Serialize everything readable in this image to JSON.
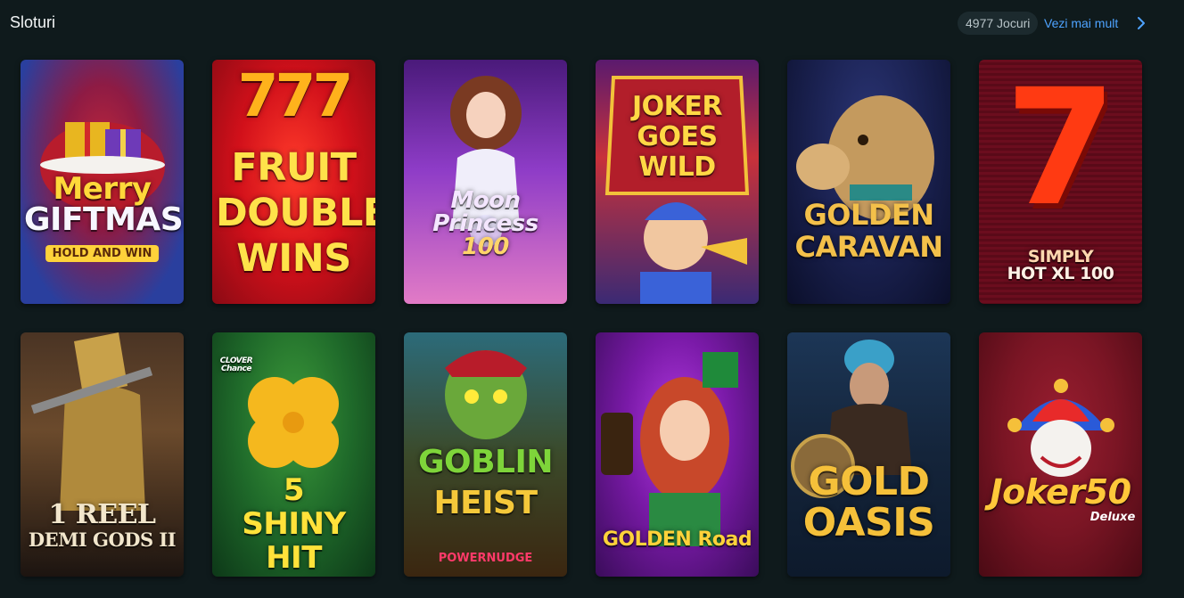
{
  "section": {
    "title": "Sloturi",
    "count_badge": "4977 Jocuri",
    "see_more_label": "Vezi mai mult",
    "chevron_icon": "chevron-right-icon"
  },
  "games": [
    {
      "id": "merry-giftmas",
      "lines": [
        "Merry",
        "GIFTMAS"
      ],
      "sub": "HOLD AND WIN",
      "colors": [
        "#2a3f9e",
        "#c2273a"
      ]
    },
    {
      "id": "fruit-double-wins",
      "lines": [
        "FRUIT",
        "DOUBLE",
        "WINS"
      ],
      "top": "777",
      "colors": [
        "#d1101a",
        "#8a0a14"
      ]
    },
    {
      "id": "moon-princess-100",
      "lines": [
        "Moon",
        "Princess",
        "100"
      ],
      "colors": [
        "#8e3cc7",
        "#e27bc6"
      ]
    },
    {
      "id": "joker-goes-wild",
      "lines": [
        "JOKER",
        "GOES",
        "WILD"
      ],
      "colors": [
        "#c8313a",
        "#3b2a74"
      ]
    },
    {
      "id": "golden-caravan",
      "lines": [
        "GOLDEN",
        "CARAVAN"
      ],
      "colors": [
        "#1a2150",
        "#0b0f2a"
      ]
    },
    {
      "id": "simply-hot-xl",
      "lines": [
        "7",
        "SIMPLY",
        "HOT XL 100"
      ],
      "colors": [
        "#6b0d1e",
        "#3d0612"
      ]
    },
    {
      "id": "1-reel-demi-gods-ii",
      "lines": [
        "1 REEL",
        "DEMI GODS II"
      ],
      "colors": [
        "#6b4a2c",
        "#1c1410"
      ]
    },
    {
      "id": "5-shiny-hit",
      "lines": [
        "5",
        "SHINY",
        "HIT"
      ],
      "top": "CLOVER Chance",
      "colors": [
        "#1f6a2a",
        "#0d3818"
      ]
    },
    {
      "id": "goblin-heist-powernudge",
      "lines": [
        "GOBLIN",
        "HEIST"
      ],
      "sub": "POWERNUDGE",
      "colors": [
        "#2c6b7a",
        "#3b2610"
      ]
    },
    {
      "id": "golden-road",
      "lines": [
        "GOLDEN Road"
      ],
      "colors": [
        "#7a1aa8",
        "#3a0c5a"
      ]
    },
    {
      "id": "gold-oasis",
      "lines": [
        "GOLD",
        "OASIS"
      ],
      "colors": [
        "#1c3656",
        "#0d1a2c"
      ]
    },
    {
      "id": "joker-50-deluxe",
      "lines": [
        "Joker50"
      ],
      "sub": "Deluxe",
      "colors": [
        "#7a1524",
        "#4a0a14"
      ]
    }
  ]
}
